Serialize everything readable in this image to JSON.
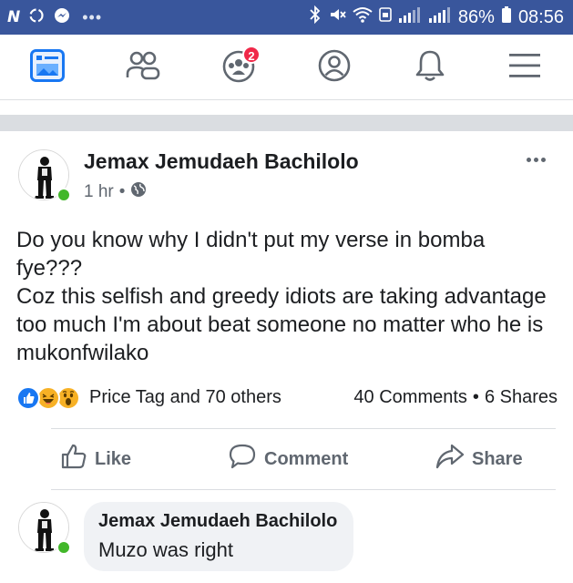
{
  "status_bar": {
    "carrier_letter": "N",
    "more": "•••",
    "battery": "86%",
    "time": "08:56"
  },
  "nav": {
    "items": [
      {
        "name": "news-feed",
        "icon": "news-feed-icon",
        "active": true
      },
      {
        "name": "friends",
        "icon": "friends-icon"
      },
      {
        "name": "groups",
        "icon": "groups-icon",
        "badge": "2"
      },
      {
        "name": "profile",
        "icon": "profile-icon"
      },
      {
        "name": "notifications",
        "icon": "bell-icon"
      },
      {
        "name": "menu",
        "icon": "hamburger-menu-icon"
      }
    ]
  },
  "post": {
    "author": "Jemax Jemudaeh Bachilolo",
    "time": "1 hr",
    "separator": "•",
    "privacy_icon": "globe-icon",
    "text_lines": [
      "Do you know why I didn't put my verse in bomba",
      "fye???",
      "Coz this selfish and greedy idiots are taking advantage",
      "too much I'm about beat someone no matter who he is",
      "mukonfwilako"
    ],
    "reactions": {
      "icons": [
        "like-reaction-icon",
        "haha-reaction-icon",
        "wow-reaction-icon"
      ],
      "text": "Price Tag and 70 others",
      "comments": "40 Comments",
      "dot": "•",
      "shares": "6 Shares"
    },
    "actions": {
      "like": "Like",
      "comment": "Comment",
      "share": "Share"
    }
  },
  "comment": {
    "author": "Jemax Jemudaeh Bachilolo",
    "text": "Muzo was right"
  },
  "colors": {
    "status_bar": "#39569c",
    "facebook_blue": "#1877f2",
    "online_green": "#42b72a",
    "badge_red": "#f02849"
  }
}
